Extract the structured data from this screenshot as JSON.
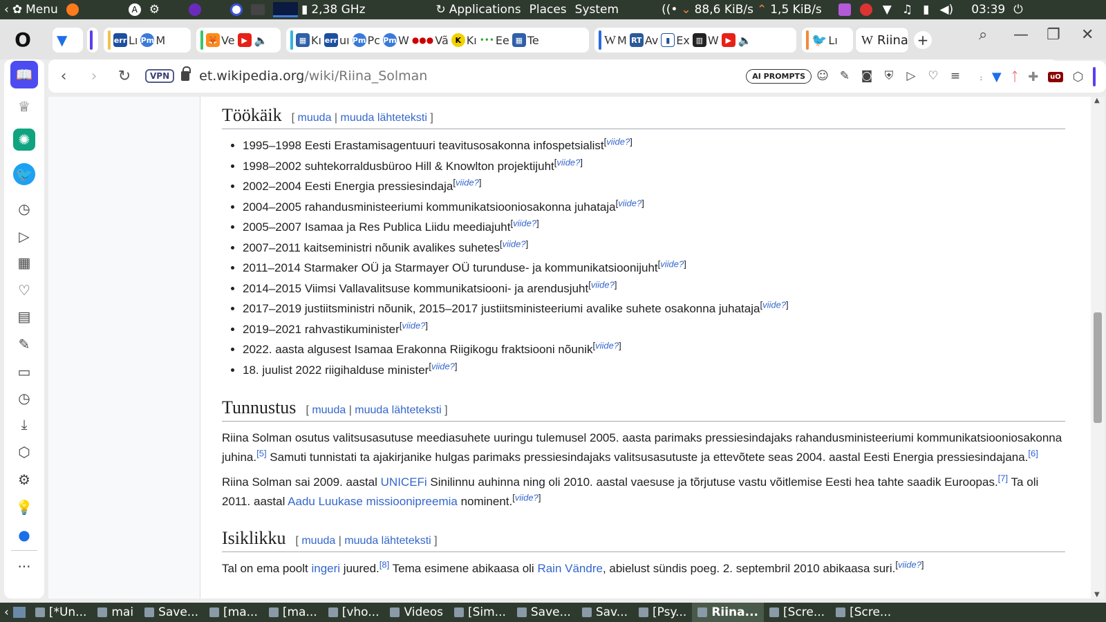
{
  "system_panel": {
    "menu_label": "Menu",
    "cpu_freq": "2,38 GHz",
    "applications": "Applications",
    "places": "Places",
    "system": "System",
    "down_speed": "88,6 KiB/s",
    "up_speed": "1,5 KiB/s",
    "clock": "03:39"
  },
  "tabs": {
    "group1": [
      "Lı",
      "M"
    ],
    "group2": [
      "Ve"
    ],
    "group3": [
      "Kı",
      "uı",
      "Pc",
      "W",
      "Vã",
      "Kı",
      "Ee",
      "Te"
    ],
    "group4": [
      "M",
      "Av",
      "Ex",
      "W"
    ],
    "group5": [
      "Lı"
    ],
    "active_tab_label": "Riina",
    "new_tab": "+"
  },
  "address": {
    "vpn_label": "VPN",
    "url_host": "et.wikipedia.org",
    "url_path": "/wiki/Riina_Solman",
    "ai_prompts": "AI PROMPTS"
  },
  "article": {
    "section_work": {
      "title": "Töökäik",
      "edit": "muuda",
      "edit_source": "muuda lähteteksti",
      "items": [
        {
          "text": "1995–1998 Eesti Erastamisagentuuri teavitusosakonna infospetsialist",
          "ref": "viide?"
        },
        {
          "text": "1998–2002 suhtekorraldusbüroo Hill & Knowlton projektijuht",
          "ref": "viide?"
        },
        {
          "text": "2002–2004 Eesti Energia pressiesindaja",
          "ref": "viide?"
        },
        {
          "text": "2004–2005 rahandusministeeriumi kommunikatsiooniosakonna juhataja",
          "ref": "viide?"
        },
        {
          "text": "2005–2007 Isamaa ja Res Publica Liidu meediajuht",
          "ref": "viide?"
        },
        {
          "text": "2007–2011 kaitseministri nõunik avalikes suhetes",
          "ref": "viide?"
        },
        {
          "text": "2011–2014 Starmaker OÜ ja Starmayer OÜ turunduse- ja kommunikatsioonijuht",
          "ref": "viide?"
        },
        {
          "text": "2014–2015 Viimsi Vallavalitsuse kommunikatsiooni- ja arendusjuht",
          "ref": "viide?"
        },
        {
          "text": "2017–2019 justiitsministri nõunik, 2015–2017 justiitsministeeriumi avalike suhete osakonna juhataja",
          "ref": "viide?"
        },
        {
          "text": "2019–2021 rahvastikuminister",
          "ref": "viide?"
        },
        {
          "text": "2022. aasta algusest Isamaa Erakonna Riigikogu fraktsiooni nõunik",
          "ref": "viide?"
        },
        {
          "text": "18. juulist 2022 riigihalduse minister",
          "ref": "viide?"
        }
      ]
    },
    "section_recognition": {
      "title": "Tunnustus",
      "edit": "muuda",
      "edit_source": "muuda lähteteksti",
      "p1_a": "Riina Solman osutus valitsusasutuse meediasuhete uuringu tulemusel 2005. aasta parimaks pressiesindajaks rahandusministeeriumi kommunikatsiooniosakonna juhina.",
      "p1_ref1": "[5]",
      "p1_b": " Samuti tunnistati ta ajakirjanike hulgas parimaks pressiesindajaks valitsusasutuste ja ettevõtete seas 2004. aastal Eesti Energia pressiesindajana.",
      "p1_ref2": "[6]",
      "p2_a": "Riina Solman sai 2009. aastal ",
      "p2_link1": "UNICEFi",
      "p2_b": " Sinilinnu auhinna ning oli 2010. aastal vaesuse ja tõrjutuse vastu võitlemise Eesti hea tahte saadik Euroopas.",
      "p2_ref1": "[7]",
      "p2_c": " Ta oli 2011. aastal ",
      "p2_link2": "Aadu Luukase missioonipreemia",
      "p2_d": " nominent.",
      "p2_ref2": "viide?"
    },
    "section_personal": {
      "title": "Isiklikku",
      "edit": "muuda",
      "edit_source": "muuda lähteteksti",
      "p_a": "Tal on ema poolt ",
      "p_link1": "ingeri",
      "p_b": " juured.",
      "p_ref1": "[8]",
      "p_c": " Tema esimene abikaasa oli ",
      "p_link2": "Rain Vändre",
      "p_d": ", abielust sündis poeg. 2. septembril 2010 abikaasa suri.",
      "p_ref2": "viide?"
    }
  },
  "taskbar": {
    "tasks": [
      "[*Un...",
      "mai",
      "Save...",
      "[ma...",
      "[ma...",
      "[vho...",
      "Videos",
      "[Sim...",
      "Save...",
      "Sav...",
      "[Psy...",
      "Riina...",
      "[Scre...",
      "[Scre..."
    ]
  }
}
